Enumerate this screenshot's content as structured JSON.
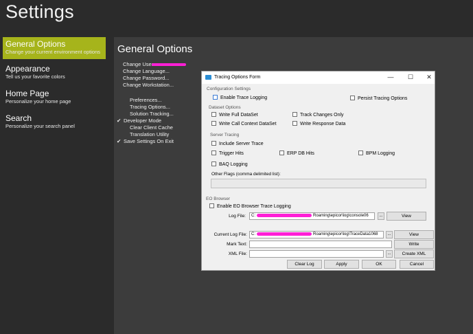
{
  "app": {
    "title": "Settings"
  },
  "nav": [
    {
      "title": "General Options",
      "subtitle": "Change your current environment options"
    },
    {
      "title": "Appearance",
      "subtitle": "Tell us your favorite colors"
    },
    {
      "title": "Home Page",
      "subtitle": "Personalize your home page"
    },
    {
      "title": "Search",
      "subtitle": "Personalize your search panel"
    }
  ],
  "main": {
    "title": "General Options",
    "change_links": [
      "Change User",
      "Change Language...",
      "Change Password...",
      "Change Workstation..."
    ],
    "option_links": [
      {
        "label": "Preferences...",
        "checked": false
      },
      {
        "label": "Tracing Options...",
        "checked": false
      },
      {
        "label": "Solution Tracking...",
        "checked": false
      },
      {
        "label": "Developer Mode",
        "checked": true
      },
      {
        "label": "Clear Client Cache",
        "checked": false
      },
      {
        "label": "Translation Utility",
        "checked": false
      },
      {
        "label": "Save Settings On Exit",
        "checked": true
      }
    ]
  },
  "dialog": {
    "title": "Tracing Options Form",
    "config_header": "Configuration Settings",
    "enable_trace": "Enable Trace Logging",
    "persist": "Persist Tracing Options",
    "dataset_header": "Dataset Options",
    "write_full": "Write Full DataSet",
    "track_changes": "Track Changes Only",
    "write_call": "Write Call Context DataSet",
    "write_response": "Write Response Data",
    "server_header": "Server Tracing",
    "include_server": "Include Server Trace",
    "trigger_hits": "Trigger Hits",
    "erp_db_hits": "ERP DB Hits",
    "bpm_logging": "BPM Logging",
    "baq_logging": "BAQ Logging",
    "other_flags_label": "Other Flags (comma delimited list):",
    "other_flags_value": "",
    "eo_header": "EO Browser",
    "enable_eo": "Enable EO Browser Trace Logging",
    "log_file_label": "Log File:",
    "log_file_value": "Roaming\\epicor\\log\\console06",
    "log_file_prefix": "C:",
    "dots": "...",
    "view": "View",
    "current_log_label": "Current Log File:",
    "current_log_value": "Roaming\\epicor\\log\\TraceData1068",
    "current_log_prefix": "C:",
    "mark_text_label": "Mark Text:",
    "mark_text_value": "",
    "write": "Write",
    "xml_file_label": "XML File:",
    "xml_file_value": "",
    "create_xml": "Create XML",
    "clear_log": "Clear Log",
    "apply": "Apply",
    "ok": "OK",
    "cancel": "Cancel",
    "controls": {
      "minimize": "—",
      "maximize": "☐",
      "close": "✕"
    }
  },
  "colors": {
    "accent": "#a6b41b",
    "redaction": "#ff1fd6",
    "background": "#2b2b2b",
    "panel": "#3c3c3c"
  }
}
